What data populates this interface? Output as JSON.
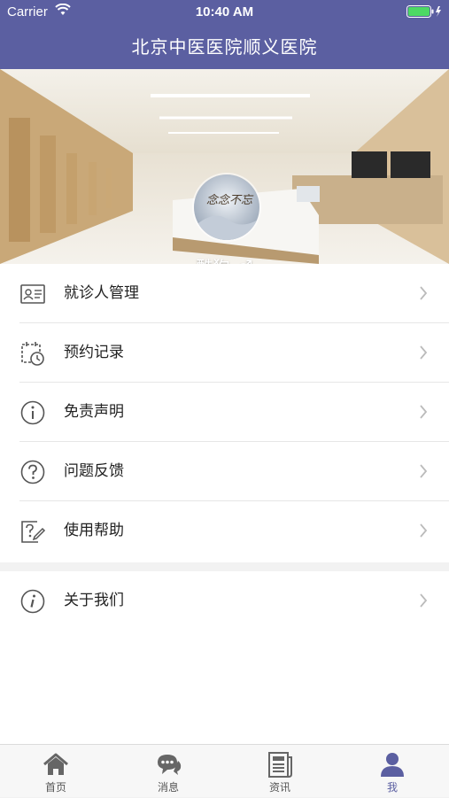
{
  "status_bar": {
    "carrier": "Carrier",
    "time": "10:40 AM"
  },
  "header": {
    "title": "北京中医医院顺义医院"
  },
  "profile": {
    "username": "酷狗",
    "gender_symbol": "♂",
    "avatar_text": "念念不忘"
  },
  "menu": {
    "items": [
      {
        "label": "就诊人管理",
        "icon": "id-card-icon"
      },
      {
        "label": "预约记录",
        "icon": "calendar-clock-icon"
      },
      {
        "label": "免责声明",
        "icon": "info-circle-icon"
      },
      {
        "label": "问题反馈",
        "icon": "question-circle-icon"
      },
      {
        "label": "使用帮助",
        "icon": "help-edit-icon"
      }
    ],
    "about": {
      "label": "关于我们",
      "icon": "italic-info-icon"
    }
  },
  "tabbar": {
    "tabs": [
      {
        "label": "首页",
        "icon": "home-icon"
      },
      {
        "label": "消息",
        "icon": "chat-icon"
      },
      {
        "label": "资讯",
        "icon": "news-icon"
      },
      {
        "label": "我",
        "icon": "user-icon"
      }
    ],
    "active_index": 3
  },
  "colors": {
    "primary": "#5b5fa1",
    "background": "#f2f2f2",
    "text": "#222222",
    "chevron": "#bbbbbb",
    "icon": "#555555"
  }
}
